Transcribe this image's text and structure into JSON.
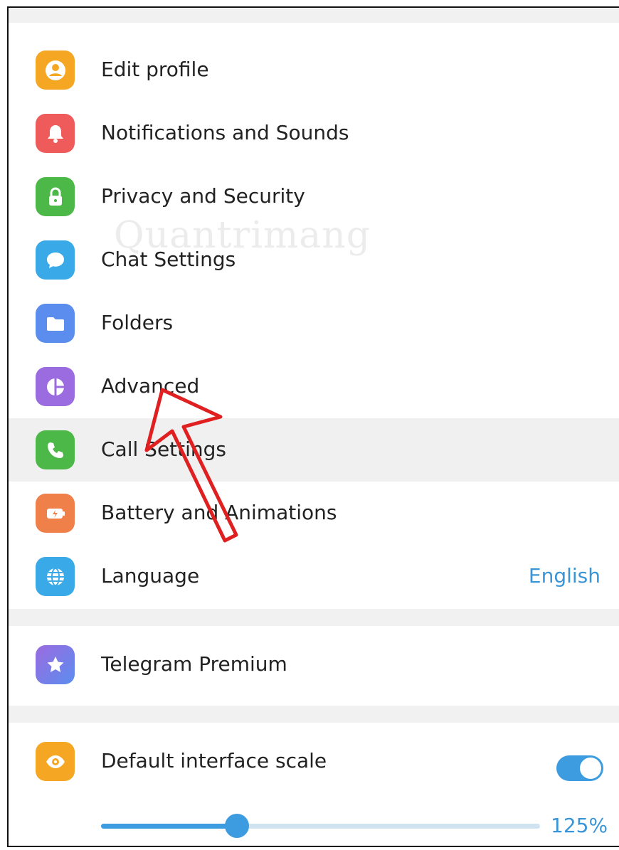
{
  "settings_list": {
    "items": [
      {
        "label": "Edit profile",
        "icon": "user-icon",
        "color": "#F5A623"
      },
      {
        "label": "Notifications and Sounds",
        "icon": "bell-icon",
        "color": "#EF5B5B"
      },
      {
        "label": "Privacy and Security",
        "icon": "lock-icon",
        "color": "#4CB848"
      },
      {
        "label": "Chat Settings",
        "icon": "chat-bubble-icon",
        "color": "#3AA9E8"
      },
      {
        "label": "Folders",
        "icon": "folder-icon",
        "color": "#5B8DEF"
      },
      {
        "label": "Advanced",
        "icon": "pie-chart-icon",
        "color": "#9B6BE0"
      },
      {
        "label": "Call Settings",
        "icon": "phone-icon",
        "color": "#4CB848"
      },
      {
        "label": "Battery and Animations",
        "icon": "battery-icon",
        "color": "#F0804A"
      },
      {
        "label": "Language",
        "icon": "globe-icon",
        "color": "#3AA9E8",
        "value": "English"
      }
    ]
  },
  "premium": {
    "label": "Telegram Premium",
    "icon": "star-icon",
    "color": "#7B6CF0"
  },
  "scale": {
    "label": "Default interface scale",
    "icon": "eye-icon",
    "color": "#F5A623",
    "toggle_on": true,
    "slider_fraction": 0.31,
    "value": "125%"
  },
  "watermark": "Quantrimang",
  "accent_color": "#3D9BE0",
  "annotation_color": "#E02020"
}
